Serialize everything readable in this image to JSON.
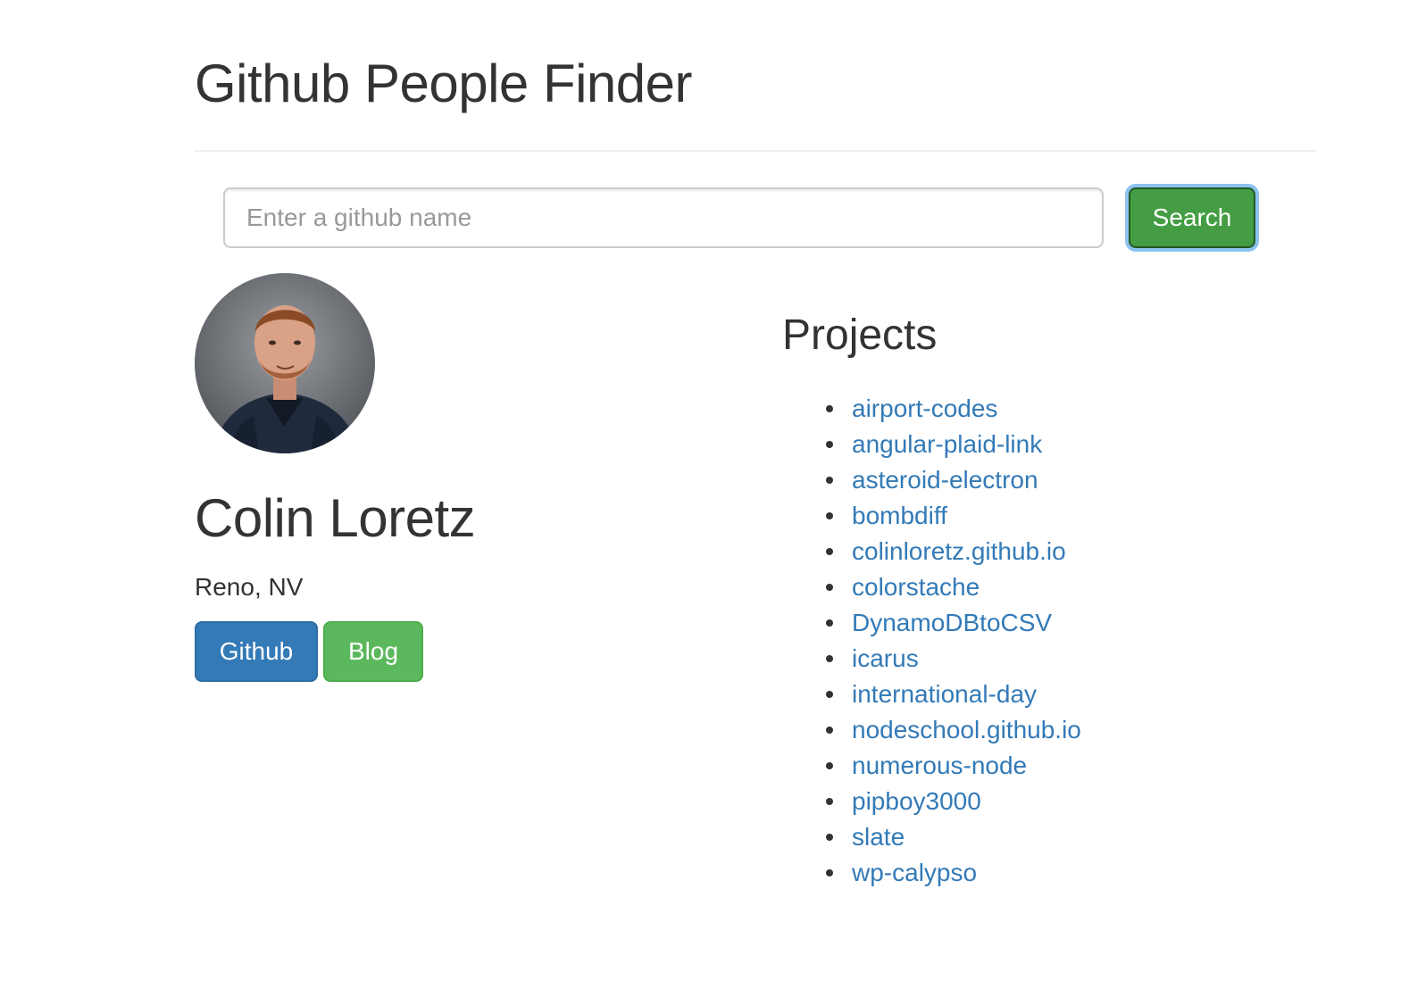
{
  "header": {
    "title": "Github People Finder"
  },
  "search": {
    "placeholder": "Enter a github name",
    "value": "",
    "button_label": "Search"
  },
  "profile": {
    "name": "Colin Loretz",
    "location": "Reno, NV",
    "avatar_icon": "user-photo",
    "buttons": {
      "github": "Github",
      "blog": "Blog"
    }
  },
  "projects": {
    "heading": "Projects",
    "items": [
      "airport-codes",
      "angular-plaid-link",
      "asteroid-electron",
      "bombdiff",
      "colinloretz.github.io",
      "colorstache",
      "DynamoDBtoCSV",
      "icarus",
      "international-day",
      "nodeschool.github.io",
      "numerous-node",
      "pipboy3000",
      "slate",
      "wp-calypso"
    ]
  },
  "colors": {
    "primary": "#337ab7",
    "success": "#5cb85c",
    "success_active": "#449d44",
    "link": "#337ab7",
    "text": "#333333"
  }
}
